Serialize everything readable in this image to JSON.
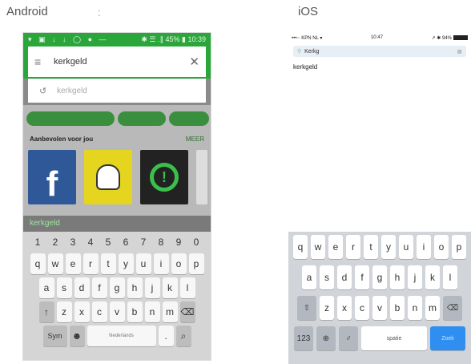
{
  "labels": {
    "android": "Android",
    "colon": ":",
    "ios": "iOS"
  },
  "android": {
    "status": {
      "left": "▾ ▣ ↓ ↓ ◯ ● —",
      "right": "✱ ☰ .∥ 45% ▮ 10:39"
    },
    "search": {
      "menu_icon": "≡",
      "query": "kerkgeld",
      "close_icon": "✕"
    },
    "suggestion": {
      "history_icon": "↺",
      "text": "kerkgeld"
    },
    "section": {
      "title": "Aanbevolen voor jou",
      "more": "MEER"
    },
    "apps": [
      "facebook-app",
      "snapchat-app",
      "third-app"
    ],
    "suggest_bar": "kerkgeld",
    "keyboard": {
      "numbers": [
        "1",
        "2",
        "3",
        "4",
        "5",
        "6",
        "7",
        "8",
        "9",
        "0"
      ],
      "row1": [
        "q",
        "w",
        "e",
        "r",
        "t",
        "y",
        "u",
        "i",
        "o",
        "p"
      ],
      "row2": [
        "a",
        "s",
        "d",
        "f",
        "g",
        "h",
        "j",
        "k",
        "l"
      ],
      "row3": [
        "z",
        "x",
        "c",
        "v",
        "b",
        "n",
        "m"
      ],
      "shift": "↑",
      "backspace": "⌫",
      "sym": "Sym",
      "emoji": "☻",
      "space": "Nederlands",
      "period": ".",
      "search": "⌕"
    },
    "colors": {
      "accent": "#2aa63a"
    }
  },
  "ios": {
    "status": {
      "carrier": "•••◦◦ KPN NL ▾",
      "time": "10:47",
      "right": "↗ ✱ 94%"
    },
    "search": {
      "query": "Kerkg",
      "clear_icon": "⊗"
    },
    "result": "kerkgeld",
    "keyboard": {
      "row1": [
        "q",
        "w",
        "e",
        "r",
        "t",
        "y",
        "u",
        "i",
        "o",
        "p"
      ],
      "row2": [
        "a",
        "s",
        "d",
        "f",
        "g",
        "h",
        "j",
        "k",
        "l"
      ],
      "row3": [
        "z",
        "x",
        "c",
        "v",
        "b",
        "n",
        "m"
      ],
      "shift": "⇧",
      "backspace": "⌫",
      "numbers": "123",
      "globe": "⊕",
      "mic": "♂",
      "space": "spatie",
      "go": "Zoek"
    },
    "colors": {
      "go": "#2e8ff0"
    }
  }
}
